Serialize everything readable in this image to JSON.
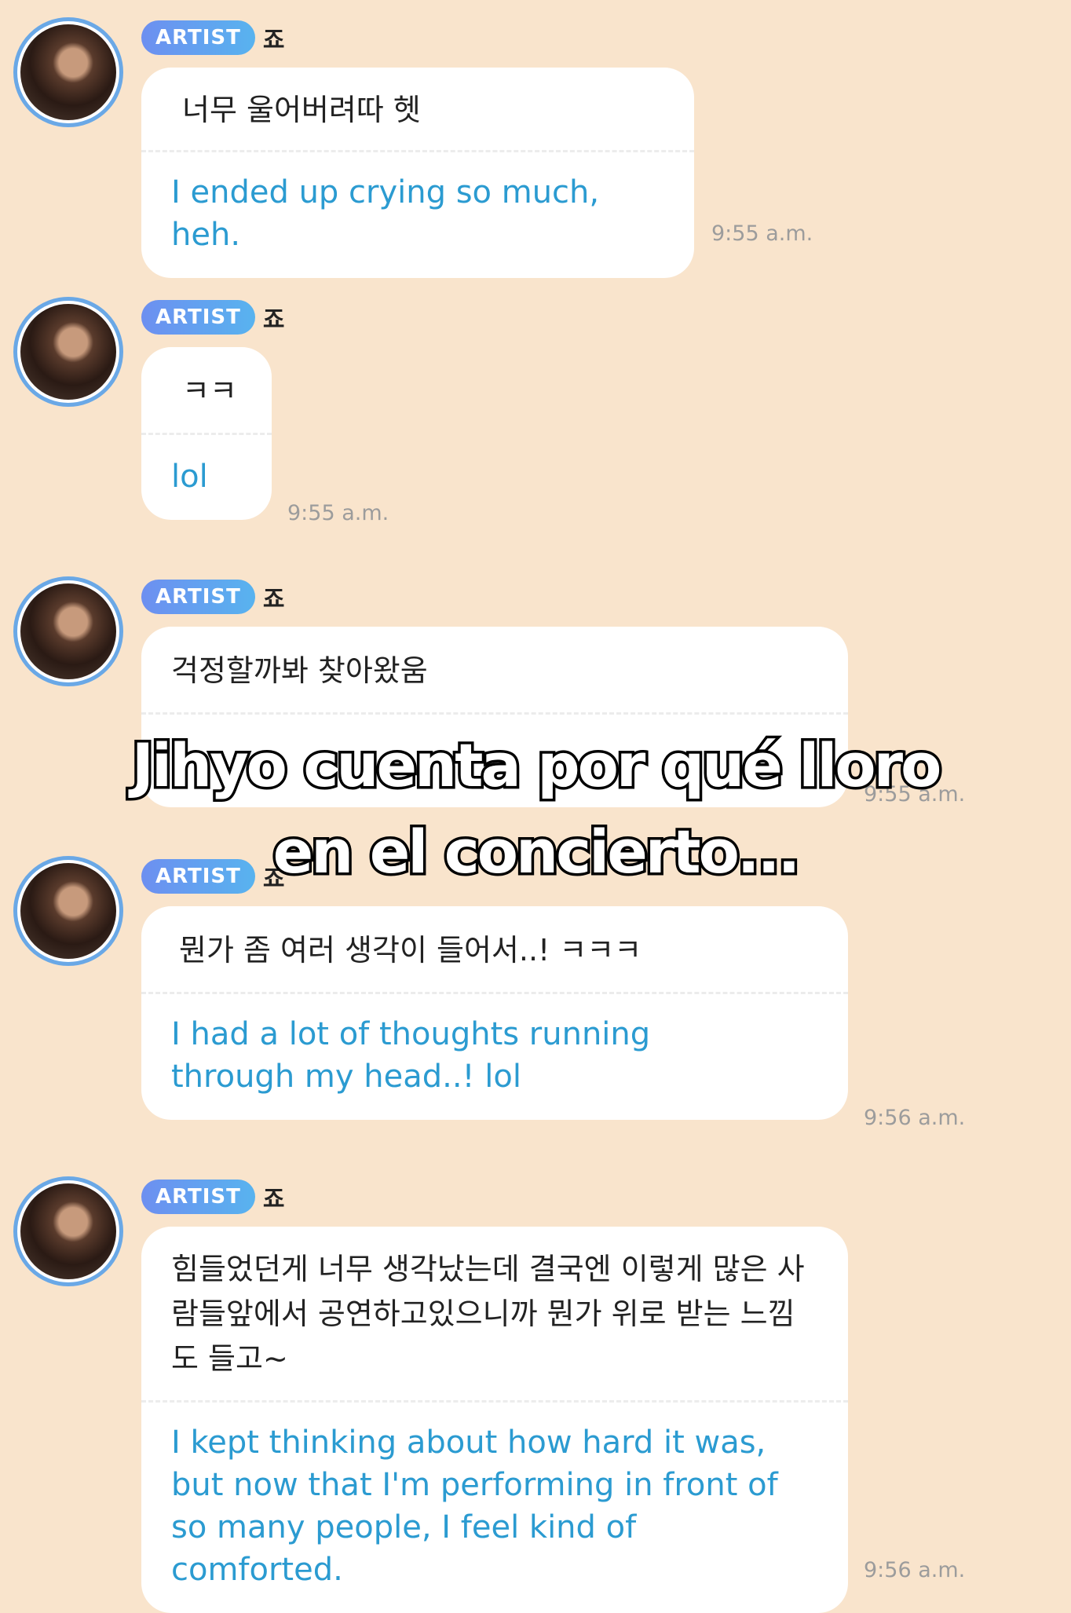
{
  "messages": [
    {
      "badge": "ARTIST",
      "sender": "죠",
      "korean": "너무 울어버려따 헷",
      "english": "I ended up crying so much, heh.",
      "time": "9:55 a.m."
    },
    {
      "badge": "ARTIST",
      "sender": "죠",
      "korean": "ㅋㅋ",
      "english": "lol",
      "time": "9:55 a.m."
    },
    {
      "badge": "ARTIST",
      "sender": "죠",
      "korean": "걱정할까봐 찾아왔움",
      "english": "",
      "time": "9:55 a.m."
    },
    {
      "badge": "ARTIST",
      "sender": "죠",
      "korean": "뭔가 좀 여러 생각이 들어서..! ㅋㅋㅋ",
      "english": "I had a lot of thoughts running through my head..! lol",
      "time": "9:56 a.m."
    },
    {
      "badge": "ARTIST",
      "sender": "죠",
      "korean": "힘들었던게 너무 생각났는데 결국엔 이렇게 많은 사람들앞에서 공연하고있으니까 뭔가 위로 받는 느낌도 들고~",
      "english": "I kept thinking about how hard it was, but now that I'm performing in front of so many people, I feel kind of comforted.",
      "time": "9:56 a.m."
    }
  ],
  "overlay_caption": {
    "line1": "Jihyo cuenta por qué lloro",
    "line2": "en el concierto..."
  }
}
